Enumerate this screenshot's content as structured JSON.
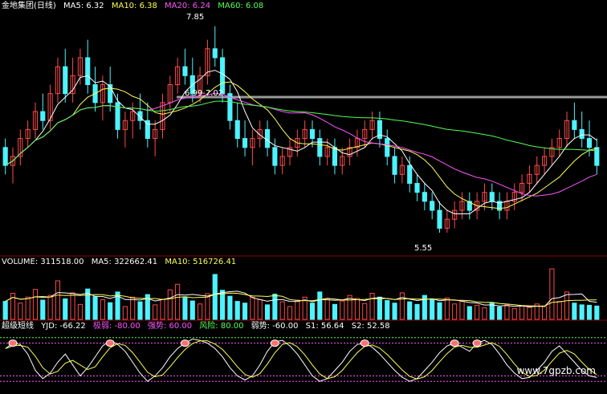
{
  "price_legend": {
    "title": "金地集团(日线)",
    "ma5": "MA5: 6.32",
    "ma10": "MA10: 6.38",
    "ma20": "MA20: 6.24",
    "ma60": "MA60: 6.08"
  },
  "volume_legend": {
    "volume": "VOLUME: 311518.00",
    "ma5": "MA5: 322662.41",
    "ma10": "MA10: 516726.41"
  },
  "indicator_legend": {
    "name": "超级短线",
    "yjd": "YJD: -66.22",
    "jiruo": "极弱: -80.00",
    "qiangshi": "强势: 60.00",
    "fengxian": "风险: 80.00",
    "ruoshi": "弱势: -60.00",
    "s1": "S1: 56.64",
    "s2": "S2: 52.58"
  },
  "annotations": {
    "high": "7.85",
    "mid": "6.99-7.02",
    "low": "5.55"
  },
  "watermark": "www.7gpzb.com",
  "colors": {
    "up": "#ff4a4a",
    "down": "#4df3ff",
    "ma5": "#ffffff",
    "ma10": "#ffff55",
    "ma20": "#ff55ff",
    "ma60": "#55ff55",
    "grid": "#8a0000"
  },
  "chart_data": [
    {
      "type": "candlestick",
      "title": "金地集团(日线)",
      "ylim": [
        5.3,
        8.0
      ],
      "candles": [
        [
          6.5,
          6.6,
          6.2,
          6.3
        ],
        [
          6.3,
          6.5,
          6.1,
          6.4
        ],
        [
          6.4,
          6.7,
          6.3,
          6.6
        ],
        [
          6.6,
          6.8,
          6.5,
          6.7
        ],
        [
          6.7,
          7.0,
          6.6,
          6.9
        ],
        [
          6.9,
          7.1,
          6.7,
          6.8
        ],
        [
          6.8,
          7.2,
          6.7,
          7.1
        ],
        [
          7.1,
          7.5,
          7.0,
          7.4
        ],
        [
          7.4,
          7.6,
          7.0,
          7.1
        ],
        [
          7.1,
          7.5,
          7.0,
          7.3
        ],
        [
          7.3,
          7.6,
          7.2,
          7.5
        ],
        [
          7.5,
          7.7,
          7.1,
          7.2
        ],
        [
          7.2,
          7.4,
          6.9,
          7.0
        ],
        [
          7.0,
          7.3,
          6.8,
          7.2
        ],
        [
          7.2,
          7.4,
          6.9,
          7.0
        ],
        [
          7.0,
          7.1,
          6.6,
          6.7
        ],
        [
          6.7,
          6.9,
          6.5,
          6.8
        ],
        [
          6.8,
          7.0,
          6.6,
          6.9
        ],
        [
          6.9,
          7.1,
          6.7,
          6.8
        ],
        [
          6.8,
          7.0,
          6.5,
          6.6
        ],
        [
          6.6,
          6.8,
          6.4,
          6.7
        ],
        [
          6.7,
          7.1,
          6.6,
          7.0
        ],
        [
          7.0,
          7.3,
          6.9,
          7.2
        ],
        [
          7.2,
          7.5,
          7.1,
          7.4
        ],
        [
          7.4,
          7.6,
          7.2,
          7.3
        ],
        [
          7.3,
          7.5,
          7.0,
          7.1
        ],
        [
          7.1,
          7.4,
          7.0,
          7.3
        ],
        [
          7.3,
          7.7,
          7.2,
          7.6
        ],
        [
          7.6,
          7.85,
          7.4,
          7.5
        ],
        [
          7.5,
          7.6,
          7.0,
          7.1
        ],
        [
          7.1,
          7.2,
          6.7,
          6.8
        ],
        [
          6.8,
          7.0,
          6.5,
          6.6
        ],
        [
          6.6,
          6.8,
          6.4,
          6.5
        ],
        [
          6.5,
          6.7,
          6.3,
          6.6
        ],
        [
          6.6,
          6.8,
          6.5,
          6.7
        ],
        [
          6.7,
          6.8,
          6.4,
          6.5
        ],
        [
          6.5,
          6.6,
          6.2,
          6.3
        ],
        [
          6.3,
          6.5,
          6.2,
          6.4
        ],
        [
          6.4,
          6.6,
          6.3,
          6.5
        ],
        [
          6.5,
          6.7,
          6.4,
          6.6
        ],
        [
          6.6,
          6.8,
          6.5,
          6.7
        ],
        [
          6.7,
          6.8,
          6.5,
          6.6
        ],
        [
          6.6,
          6.7,
          6.3,
          6.4
        ],
        [
          6.4,
          6.6,
          6.3,
          6.5
        ],
        [
          6.5,
          6.6,
          6.2,
          6.3
        ],
        [
          6.3,
          6.5,
          6.2,
          6.4
        ],
        [
          6.4,
          6.6,
          6.3,
          6.5
        ],
        [
          6.5,
          6.7,
          6.4,
          6.6
        ],
        [
          6.6,
          6.8,
          6.5,
          6.7
        ],
        [
          6.7,
          6.9,
          6.6,
          6.8
        ],
        [
          6.8,
          6.9,
          6.5,
          6.6
        ],
        [
          6.6,
          6.7,
          6.3,
          6.4
        ],
        [
          6.4,
          6.5,
          6.1,
          6.2
        ],
        [
          6.2,
          6.4,
          6.1,
          6.3
        ],
        [
          6.3,
          6.4,
          6.0,
          6.1
        ],
        [
          6.1,
          6.2,
          5.9,
          6.0
        ],
        [
          6.0,
          6.1,
          5.8,
          5.9
        ],
        [
          5.9,
          6.0,
          5.7,
          5.8
        ],
        [
          5.8,
          5.9,
          5.55,
          5.6
        ],
        [
          5.6,
          5.8,
          5.55,
          5.7
        ],
        [
          5.7,
          5.9,
          5.6,
          5.8
        ],
        [
          5.8,
          6.0,
          5.7,
          5.9
        ],
        [
          5.9,
          6.0,
          5.7,
          5.8
        ],
        [
          5.8,
          6.0,
          5.7,
          5.9
        ],
        [
          5.9,
          6.1,
          5.8,
          6.0
        ],
        [
          6.0,
          6.1,
          5.8,
          5.9
        ],
        [
          5.9,
          6.0,
          5.7,
          5.8
        ],
        [
          5.8,
          6.0,
          5.7,
          5.9
        ],
        [
          5.9,
          6.1,
          5.8,
          6.0
        ],
        [
          6.0,
          6.2,
          5.9,
          6.1
        ],
        [
          6.1,
          6.3,
          6.0,
          6.2
        ],
        [
          6.2,
          6.4,
          6.1,
          6.3
        ],
        [
          6.3,
          6.5,
          6.2,
          6.4
        ],
        [
          6.4,
          6.6,
          6.3,
          6.5
        ],
        [
          6.5,
          6.7,
          6.4,
          6.6
        ],
        [
          6.6,
          6.9,
          6.5,
          6.8
        ],
        [
          6.8,
          7.0,
          6.6,
          6.7
        ],
        [
          6.7,
          6.9,
          6.5,
          6.6
        ],
        [
          6.6,
          6.8,
          6.4,
          6.5
        ],
        [
          6.5,
          6.6,
          6.2,
          6.3
        ]
      ]
    },
    {
      "type": "bar",
      "ylim": [
        0,
        1200000
      ],
      "values": [
        420000,
        610000,
        380000,
        520000,
        700000,
        450000,
        560000,
        900000,
        480000,
        620000,
        350000,
        710000,
        530000,
        460000,
        390000,
        640000,
        300000,
        520000,
        410000,
        580000,
        340000,
        470000,
        690000,
        820000,
        510000,
        430000,
        360000,
        600000,
        1050000,
        680000,
        540000,
        420000,
        380000,
        520000,
        460000,
        340000,
        590000,
        410000,
        300000,
        450000,
        520000,
        380000,
        640000,
        480000,
        350000,
        430000,
        560000,
        490000,
        370000,
        610000,
        520000,
        440000,
        380000,
        620000,
        410000,
        350000,
        560000,
        470000,
        390000,
        500000,
        360000,
        420000,
        300000,
        330000,
        270000,
        380000,
        290000,
        340000,
        250000,
        310000,
        280000,
        360000,
        300000,
        1180000,
        420000,
        640000,
        380000,
        340000,
        330000,
        311518
      ]
    },
    {
      "type": "line",
      "ylim": [
        -100,
        100
      ],
      "values": [
        40,
        60,
        55,
        20,
        -40,
        -70,
        -50,
        -10,
        20,
        -20,
        -60,
        -30,
        10,
        50,
        70,
        55,
        30,
        -10,
        -50,
        -80,
        -60,
        -30,
        10,
        40,
        60,
        75,
        70,
        60,
        40,
        10,
        -30,
        -60,
        -75,
        -60,
        -20,
        30,
        65,
        70,
        50,
        20,
        -20,
        -60,
        -80,
        -70,
        -40,
        -10,
        30,
        55,
        60,
        45,
        20,
        -10,
        -40,
        -65,
        -80,
        -70,
        -40,
        -10,
        25,
        50,
        60,
        45,
        30,
        60,
        70,
        55,
        20,
        -20,
        -50,
        -70,
        -66,
        -40,
        -10,
        30,
        50,
        20,
        -10,
        -40,
        -60,
        -66
      ],
      "levels": {
        "jiruo": -80,
        "qiangshi": 60,
        "fengxian": 80,
        "ruoshi": -60,
        "s1": 56.64,
        "s2": 52.58
      }
    }
  ]
}
